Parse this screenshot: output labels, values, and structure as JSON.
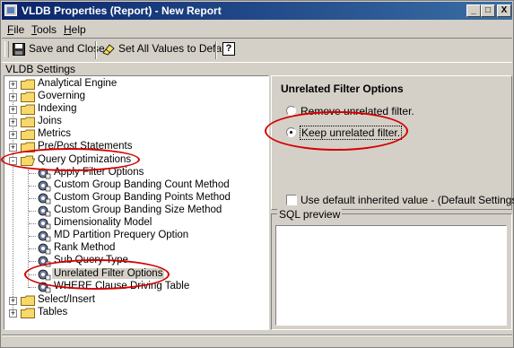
{
  "window": {
    "title": "VLDB Properties (Report) - New Report",
    "controls": [
      "_",
      "□",
      "X"
    ]
  },
  "menu": [
    "File",
    "Tools",
    "Help"
  ],
  "menu_mnemonics": [
    "F",
    "T",
    "H"
  ],
  "toolbar": {
    "save_label": "Save and Close",
    "set_all_label": "Set All Values to Default",
    "help_glyph": "?"
  },
  "section_label": "VLDB Settings",
  "tree": {
    "top_items": [
      {
        "label": "Analytical Engine",
        "expander": "+"
      },
      {
        "label": "Governing",
        "expander": "+"
      },
      {
        "label": "Indexing",
        "expander": "+"
      },
      {
        "label": "Joins",
        "expander": "+"
      },
      {
        "label": "Metrics",
        "expander": "+"
      },
      {
        "label": "Pre/Post Statements",
        "expander": "+"
      },
      {
        "label": "Query Optimizations",
        "expander": "-"
      }
    ],
    "children": [
      "Apply Filter Options",
      "Custom Group Banding Count Method",
      "Custom Group Banding Points Method",
      "Custom Group Banding Size Method",
      "Dimensionality Model",
      "MD Partition Prequery Option",
      "Rank Method",
      "Sub Query Type",
      "Unrelated Filter Options",
      "WHERE Clause Driving Table"
    ],
    "selected_child": "Unrelated Filter Options",
    "bottom_items": [
      {
        "label": "Select/Insert",
        "expander": "+"
      },
      {
        "label": "Tables",
        "expander": "+"
      }
    ]
  },
  "options_panel": {
    "title": "Unrelated Filter Options",
    "options": [
      {
        "label": "Remove unrelated filter.",
        "selected": false
      },
      {
        "label": "Keep unrelated filter.",
        "selected": true
      }
    ],
    "default_checkbox": {
      "label": "Use default inherited value - (Default Settings )",
      "checked": false
    }
  },
  "sql_preview": {
    "label": "SQL preview",
    "content": ""
  },
  "colors": {
    "titlebar_start": "#0a246a",
    "titlebar_end": "#3a6ea5",
    "annotation": "#d40000",
    "face": "#d4d0c8"
  }
}
